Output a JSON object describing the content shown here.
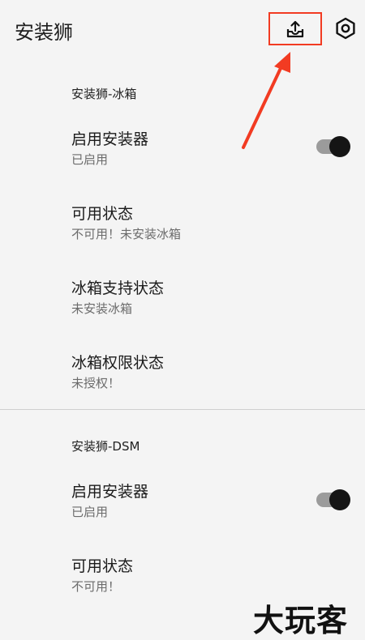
{
  "app": {
    "title": "安装狮"
  },
  "toolbar": {
    "upload_icon": "upload-tray-icon",
    "settings_icon": "settings-hex-icon",
    "highlight_color": "#f23b22"
  },
  "sections": [
    {
      "header": "安装狮-冰箱",
      "items": [
        {
          "title": "启用安装器",
          "subtitle": "已启用",
          "switch_on": true
        },
        {
          "title": "可用状态",
          "subtitle": "不可用！未安装冰箱"
        },
        {
          "title": "冰箱支持状态",
          "subtitle": "未安装冰箱"
        },
        {
          "title": "冰箱权限状态",
          "subtitle": "未授权！"
        }
      ]
    },
    {
      "header": "安装狮-DSM",
      "items": [
        {
          "title": "启用安装器",
          "subtitle": "已启用",
          "switch_on": true
        },
        {
          "title": "可用状态",
          "subtitle": "不可用！"
        }
      ]
    }
  ],
  "watermark": "大玩客"
}
